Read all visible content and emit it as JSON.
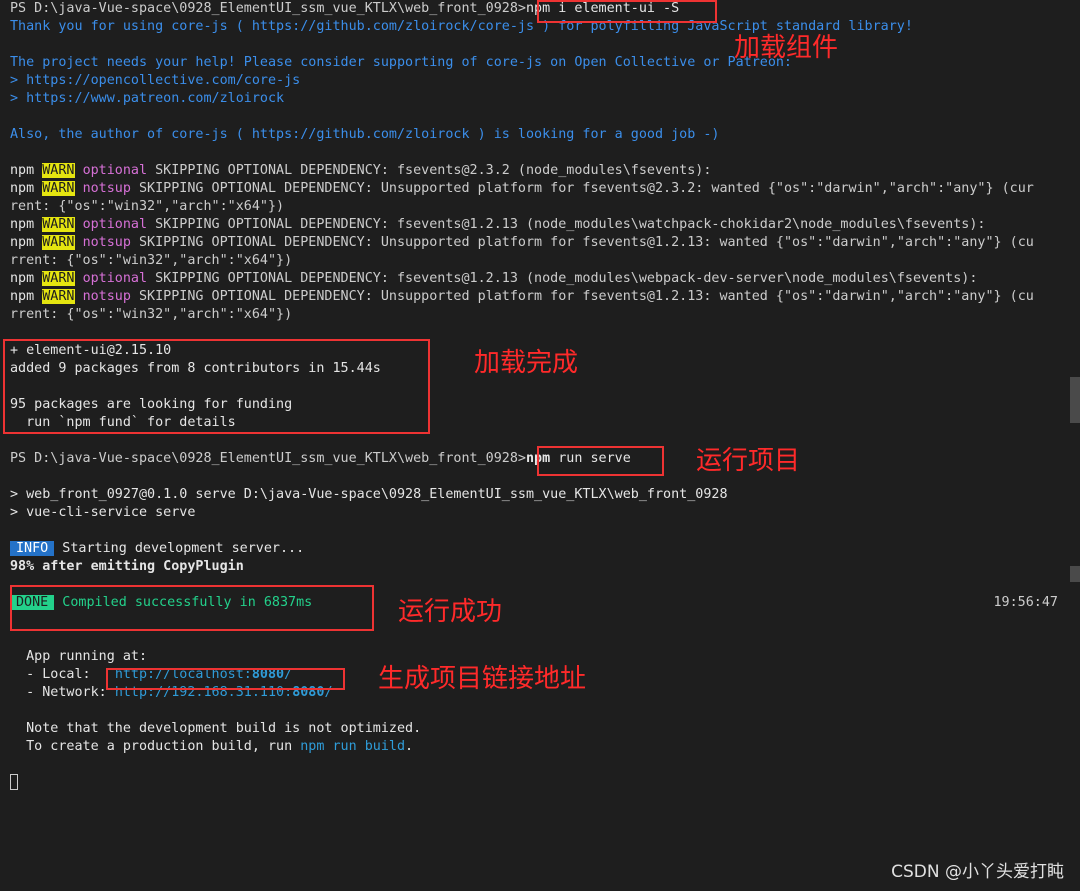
{
  "terminal": {
    "prompt1": "PS D:\\java-Vue-space\\0928_ElementUI_ssm_vue_KTLX\\web_front_0928>",
    "cmd1": "npm i element-ui -S",
    "thanks": "Thank you for using core-js ( https://github.com/zloirock/core-js ) for polyfilling JavaScript standard library!",
    "help": "The project needs your help! Please consider supporting of core-js on Open Collective or Patreon:",
    "link1": "> https://opencollective.com/core-js",
    "link2": "> https://www.patreon.com/zloirock",
    "also": "Also, the author of core-js ( https://github.com/zloirock ) is looking for a good job -)",
    "warn_npm": "npm",
    "warn_label": "WARN",
    "tag_optional": "optional",
    "tag_notsup": "notsup",
    "w1": " SKIPPING OPTIONAL DEPENDENCY: fsevents@2.3.2 (node_modules\\fsevents):",
    "w2": " SKIPPING OPTIONAL DEPENDENCY: Unsupported platform for fsevents@2.3.2: wanted {\"os\":\"darwin\",\"arch\":\"any\"} (cur",
    "w2b": "rent: {\"os\":\"win32\",\"arch\":\"x64\"})",
    "w3": " SKIPPING OPTIONAL DEPENDENCY: fsevents@1.2.13 (node_modules\\watchpack-chokidar2\\node_modules\\fsevents):",
    "w4": " SKIPPING OPTIONAL DEPENDENCY: Unsupported platform for fsevents@1.2.13: wanted {\"os\":\"darwin\",\"arch\":\"any\"} (cu",
    "w4b": "rrent: {\"os\":\"win32\",\"arch\":\"x64\"})",
    "w5": " SKIPPING OPTIONAL DEPENDENCY: fsevents@1.2.13 (node_modules\\webpack-dev-server\\node_modules\\fsevents):",
    "w6": " SKIPPING OPTIONAL DEPENDENCY: Unsupported platform for fsevents@1.2.13: wanted {\"os\":\"darwin\",\"arch\":\"any\"} (cu",
    "w6b": "rrent: {\"os\":\"win32\",\"arch\":\"x64\"})",
    "added1": "+ element-ui@2.15.10",
    "added2": "added 9 packages from 8 contributors in 15.44s",
    "funding1": "95 packages are looking for funding",
    "funding2": "  run `npm fund` for details",
    "prompt2": "PS D:\\java-Vue-space\\0928_ElementUI_ssm_vue_KTLX\\web_front_0928>",
    "cmd2_npm": "npm",
    "cmd2_rest": " run serve",
    "serve1": "> web_front_0927@0.1.0 serve D:\\java-Vue-space\\0928_ElementUI_ssm_vue_KTLX\\web_front_0928",
    "serve2": "> vue-cli-service serve",
    "info_badge": "INFO",
    "info_text": " Starting development server...",
    "emitting": "98% after emitting CopyPlugin",
    "done_badge": "DONE",
    "done_text": " Compiled successfully in 6837ms",
    "timestamp": "19:56:47",
    "app_running": "  App running at:",
    "local_label": "  - Local:   ",
    "local_url_a": "http://localhost:",
    "local_url_port": "8080",
    "local_url_b": "/",
    "network_label": "  - Network: ",
    "network_url_a": "http://192.168.31.110:",
    "network_url_port": "8080",
    "network_url_b": "/",
    "note1": "  Note that the development build is not optimized.",
    "note2_a": "  To create a production build, run ",
    "note2_cmd": "npm run build",
    "note2_b": "."
  },
  "annotations": {
    "load_component": "加载组件",
    "load_complete": "加载完成",
    "run_project": "运行项目",
    "run_success": "运行成功",
    "gen_link": "生成项目链接地址"
  },
  "watermark": "CSDN @小丫头爱打盹",
  "colors": {
    "background": "#1e1e1e",
    "annotation_red": "#ff2a2a",
    "warn_yellow": "#e5e510",
    "info_blue": "#2472c8",
    "done_green": "#23d18b",
    "link_blue": "#2f9cd8",
    "magenta": "#d670d6"
  }
}
